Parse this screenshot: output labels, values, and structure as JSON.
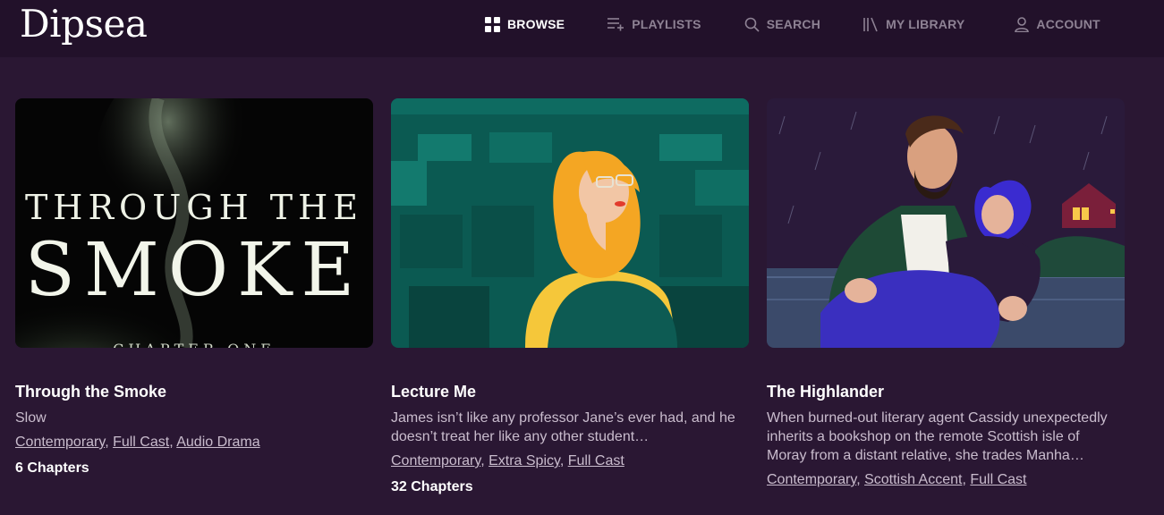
{
  "header": {
    "logo": "Dipsea",
    "nav": [
      {
        "label": "BROWSE",
        "icon": "grid-icon",
        "active": true
      },
      {
        "label": "PLAYLISTS",
        "icon": "playlist-add-icon",
        "active": false
      },
      {
        "label": "SEARCH",
        "icon": "search-icon",
        "active": false
      },
      {
        "label": "MY LIBRARY",
        "icon": "library-icon",
        "active": false
      },
      {
        "label": "ACCOUNT",
        "icon": "user-icon",
        "active": false
      }
    ]
  },
  "colors": {
    "background": "#2a1733",
    "header": "#22122a",
    "nav_inactive": "#8e8294",
    "text_secondary": "#c9bccd"
  },
  "cards": [
    {
      "title": "Through the Smoke",
      "description": "Slow",
      "cover": {
        "line1": "THROUGH THE",
        "line2": "SMOKE",
        "line3": "CHAPTER ONE"
      },
      "tags": [
        "Contemporary",
        "Full Cast",
        "Audio Drama"
      ],
      "chapters": "6 Chapters"
    },
    {
      "title": "Lecture Me",
      "description": "James isn’t like any professor Jane’s ever had, and he doesn’t treat her like any other student…",
      "tags": [
        "Contemporary",
        "Extra Spicy",
        "Full Cast"
      ],
      "chapters": "32 Chapters"
    },
    {
      "title": "The Highlander",
      "description": "When burned-out literary agent Cassidy unexpectedly inherits a bookshop on the remote Scottish isle of Moray from a distant relative, she trades Manha…",
      "tags": [
        "Contemporary",
        "Scottish Accent",
        "Full Cast"
      ]
    }
  ]
}
